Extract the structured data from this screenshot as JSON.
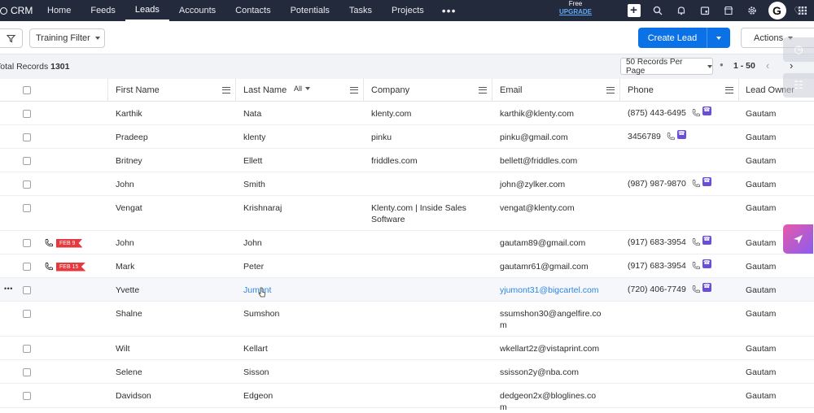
{
  "nav": {
    "brand": "CRM",
    "items": [
      "Home",
      "Feeds",
      "Leads",
      "Accounts",
      "Contacts",
      "Potentials",
      "Tasks",
      "Projects"
    ],
    "active": "Leads",
    "more": "•••",
    "trial": {
      "free": "Free",
      "upgrade": "UPGRADE"
    }
  },
  "toolbar": {
    "filter_label": "Training Filter",
    "create_label": "Create Lead",
    "actions_label": "Actions"
  },
  "records": {
    "total_label": "Total Records",
    "total_count": "1301",
    "per_page": "50 Records Per Page",
    "range": "1 - 50"
  },
  "columns": {
    "first_name": "First Name",
    "last_name": "Last Name",
    "last_name_filter": "All",
    "company": "Company",
    "email": "Email",
    "phone": "Phone",
    "lead_owner": "Lead Owner"
  },
  "rows": [
    {
      "first": "Karthik",
      "last": "Nata",
      "company": "klenty.com",
      "email": "karthik@klenty.com",
      "phone": "(875) 443-6495",
      "owner": "Gautam",
      "date_tag": ""
    },
    {
      "first": "Pradeep",
      "last": "klenty",
      "company": "pinku",
      "email": "pinku@gmail.com",
      "phone": "3456789",
      "owner": "Gautam",
      "date_tag": ""
    },
    {
      "first": "Britney",
      "last": "Ellett",
      "company": "friddles.com",
      "email": "bellett@friddles.com",
      "phone": "",
      "owner": "Gautam",
      "date_tag": ""
    },
    {
      "first": "John",
      "last": "Smith",
      "company": "",
      "email": "john@zylker.com",
      "phone": "(987) 987-9870",
      "owner": "Gautam",
      "date_tag": ""
    },
    {
      "first": "Vengat",
      "last": "Krishnaraj",
      "company": "Klenty.com | Inside Sales",
      "company2": "Software",
      "email": "vengat@klenty.com",
      "phone": "",
      "owner": "Gautam",
      "date_tag": ""
    },
    {
      "first": "John",
      "last": "John",
      "company": "",
      "email": "gautam89@gmail.com",
      "phone": "(917) 683-3954",
      "owner": "Gautam",
      "date_tag": "FEB 9"
    },
    {
      "first": "Mark",
      "last": "Peter",
      "company": "",
      "email": "gautamr61@gmail.com",
      "phone": "(917) 683-3954",
      "owner": "Gautam",
      "date_tag": "FEB 15"
    },
    {
      "first": "Yvette",
      "last": "Jumont",
      "company": "",
      "email": "yjumont31@bigcartel.com",
      "phone": "(720) 406-7749",
      "owner": "Gautam",
      "date_tag": ""
    },
    {
      "first": "Shalne",
      "last": "Sumshon",
      "company": "",
      "email": "ssumshon30@angelfire.co",
      "email2": "m",
      "phone": "",
      "owner": "Gautam",
      "date_tag": ""
    },
    {
      "first": "Wilt",
      "last": "Kellart",
      "company": "",
      "email": "wkellart2z@vistaprint.com",
      "phone": "",
      "owner": "Gautam",
      "date_tag": ""
    },
    {
      "first": "Selene",
      "last": "Sisson",
      "company": "",
      "email": "ssisson2y@nba.com",
      "phone": "",
      "owner": "Gautam",
      "date_tag": ""
    },
    {
      "first": "Davidson",
      "last": "Edgeon",
      "company": "",
      "email": "dedgeon2x@bloglines.co",
      "email2": "m",
      "phone": "",
      "owner": "Gautam",
      "date_tag": ""
    }
  ],
  "row_more": "•••",
  "colors": {
    "nav_bg": "#232a3b",
    "primary": "#0b71e6",
    "tag_red": "#e6383f",
    "link": "#2d86e0",
    "call_badge": "#6a4fd6"
  }
}
